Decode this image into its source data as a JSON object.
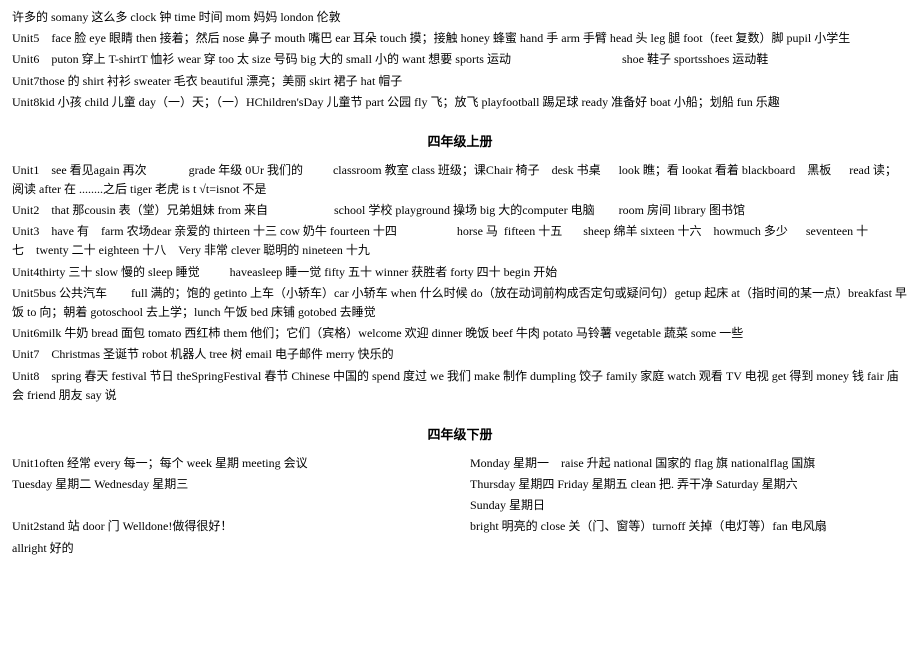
{
  "sections": [
    {
      "type": "plain",
      "lines": [
        "许多的 somany 这么多 clock 钟 time 时间 mom 妈妈 london 伦敦",
        "Unit5    face 脸 eye 眼睛 then 接着；然后 nose 鼻子 mouth 嘴巴 ear 耳朵 touch 摸；接触 honey 蜂蜜 hand 手 arm 手臂 head 头 leg 腿 foot（feet 复数）脚 pupil 小学生",
        "Unit6    puton 穿上 T-shirtT 恤衫 wear 穿 too 太 size 号码 big 大的 small 小的 want 想要 sports 运动    shoe 鞋子 sportsshoes 运动鞋",
        "Unit7those 的 shirt 衬衫 sweater 毛衣 beautiful 漂亮；美丽 skirt 裙子 hat 帽子",
        "Unit8kid 小孩 child 儿童 day（一）天；（一）HChildren'sDay 儿童节 part 公园 fly 飞；放飞 playfootball 踢足球 ready 准备好 boat 小船；划船 fun 乐趣"
      ]
    },
    {
      "type": "section",
      "title": "四年级上册",
      "lines": [
        "Unit1    see 看见again 再次              grade 年级 0Ur 我们的          classroom 教室 class 班级；课Chair 椅子    desk 书桌      look 瞧；看 lookat 看着 blackboard    黑板      read 读；阅读 after 在 ........之后 tiger 老虎 is t √t=isnot 不是",
        "Unit2    that 那cousin 表（堂）兄弟姐妹 from 来自                    school 学校 playground 操场 big 大的computer 电脑        room 房间 library 图书馆",
        "Unit3    have 有    farm 农场dear 亲爱的 thirteen 十三 cow 奶牛 fourteen 十四                    horse 马  fifteen 十五       sheep 绵羊 sixteen 十六    howmuch 多少      seventeen 十七    twenty 二十 eighteen 十八    Very 非常 clever 聪明的 nineteen 十九",
        "Unit4thirty 三十 slow 慢的 sleep 睡觉          haveasleep 睡一觉 fifty 五十 winner 获胜者 forty 四十 begin 开始",
        "Unit5bus 公共汽车        full 满的；饱的 getinto 上车（小轿车）car 小轿车 when 什么时候 do（放在动词前构成否定句或疑问句）getup 起床 at（指时间的某一点）breakfast 早饭 to 向；朝着 gotoschool 去上学；lunch 午饭 bed 床铺 gotobed 去睡觉",
        "Unit6milk 牛奶 bread 面包 tomato 西红柿 them 他们；它们（宾格）welcome 欢迎 dinner 晚饭 beef 牛肉 potato 马铃薯 vegetable 蔬菜 some 一些",
        "Unit7    Christmas 圣诞节 robot 机器人 tree 树 email 电子邮件 merry 快乐的",
        "Unit8    spring 春天 festival 节日 theSpringFestival 春节 Chinese 中国的 spend 度过 we 我们 make 制作 dumpling 饺子 family 家庭 watch 观看 TV 电视 get 得到 money 钱 fair 庙会 friend 朋友 say 说"
      ]
    },
    {
      "type": "section",
      "title": "四年级下册",
      "lines_left": [
        "Unit1often 经常 every 每一；每个 week 星期 meeting 会议",
        "Tuesday 星期二 Wednesday 星期三",
        "",
        "Unit2stand 站 door 门 Welldone!做得很好！",
        "allright 好的"
      ],
      "lines_right": [
        "Monday 星期一    raise 升起 national 国家的 flag 旗 nationalflag 国旗",
        "Thursday 星期四 Friday 星期五 clean 把. 弄干净 Saturday 星期六",
        "Sunday 星期日",
        "bright 明亮的 close 关（门、窗等）turnoff 关掉（电灯等）fan 电风扇"
      ]
    }
  ]
}
